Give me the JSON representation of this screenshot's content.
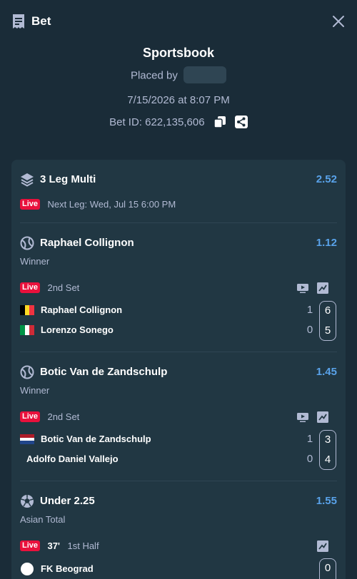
{
  "header": {
    "title": "Bet"
  },
  "summary": {
    "book": "Sportsbook",
    "placed_by_label": "Placed by",
    "datetime": "7/15/2026 at 8:07 PM",
    "bet_id": "Bet ID: 622,135,606"
  },
  "multi": {
    "title": "3 Leg Multi",
    "odds": "2.52",
    "live_label": "Live",
    "next_leg": "Next Leg: Wed, Jul 15 6:00 PM"
  },
  "legs": [
    {
      "title": "Raphael Collignon",
      "odds": "1.12",
      "market": "Winner",
      "live_label": "Live",
      "period": "2nd Set",
      "players": [
        {
          "name": "Raphael Collignon",
          "sets": "1",
          "games": "6",
          "flag": [
            "#000000",
            "#fdda24",
            "#ef3340"
          ]
        },
        {
          "name": "Lorenzo Sonego",
          "sets": "0",
          "games": "5",
          "flag": [
            "#009246",
            "#ffffff",
            "#ce2b37"
          ]
        }
      ]
    },
    {
      "title": "Botic Van de Zandschulp",
      "odds": "1.45",
      "market": "Winner",
      "live_label": "Live",
      "period": "2nd Set",
      "players": [
        {
          "name": "Botic Van de Zandschulp",
          "sets": "1",
          "games": "3",
          "flag": [
            "#ae1c28",
            "#ffffff",
            "#21468b"
          ]
        },
        {
          "name": "Adolfo Daniel Vallejo",
          "sets": "0",
          "games": "4"
        }
      ]
    },
    {
      "title": "Under 2.25",
      "odds": "1.55",
      "market": "Asian Total",
      "live_label": "Live",
      "minute": "37'",
      "period": "1st Half",
      "teams": [
        {
          "name": "FK Beograd",
          "score": "0"
        }
      ]
    }
  ],
  "colors": {
    "background": "#1a2c38",
    "card": "#213743",
    "accent": "#59a2e9",
    "live": "#e9113c",
    "muted": "#b1bad3"
  }
}
